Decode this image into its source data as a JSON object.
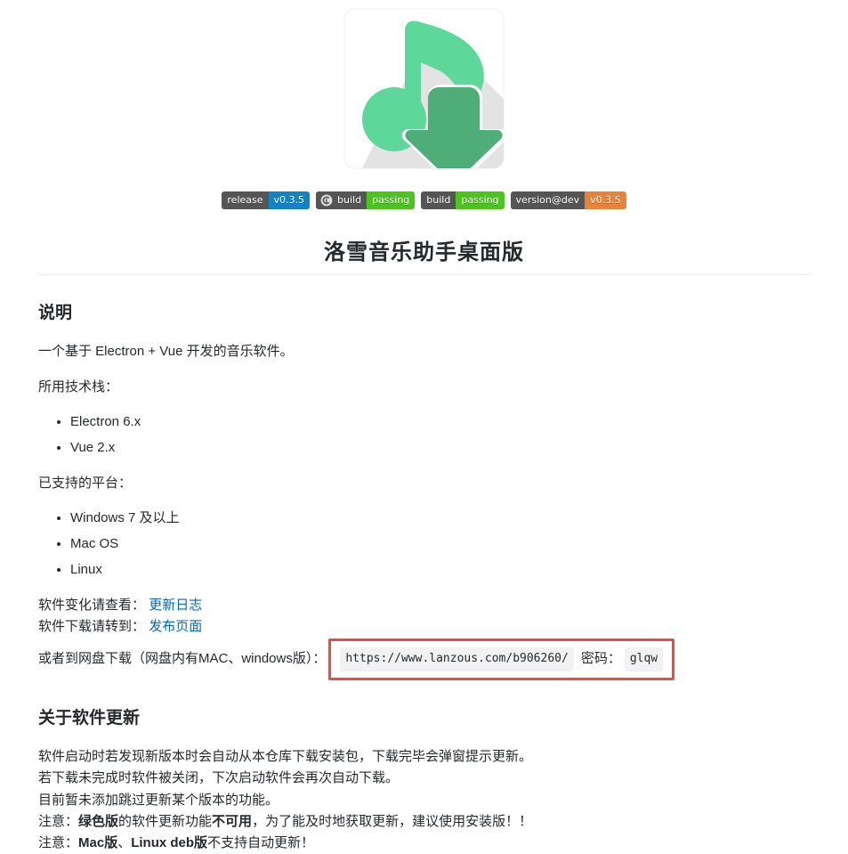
{
  "logo": {
    "name": "lx-music-logo",
    "colors": {
      "note_green": "#5ed79b",
      "arrow_green": "#4fae78",
      "shadow_gray": "#e2e2e2",
      "plate_white": "#ffffff"
    }
  },
  "badges": [
    {
      "name": "release-badge",
      "left_label": "release",
      "right_label": "v0.3.5",
      "left_color": "#555555",
      "right_color": "#1283c3",
      "icon": null
    },
    {
      "name": "travis-build-badge",
      "left_label": "build",
      "right_label": "passing",
      "left_color": "#555555",
      "right_color": "#4bc51d",
      "icon": "travis-ci-icon"
    },
    {
      "name": "build-badge",
      "left_label": "build",
      "right_label": "passing",
      "left_color": "#555555",
      "right_color": "#4bc51d",
      "icon": null
    },
    {
      "name": "version-dev-badge",
      "left_label": "version@dev",
      "right_label": "v0.3.5",
      "left_color": "#555555",
      "right_color": "#e8833a",
      "icon": null
    }
  ],
  "title": "洛雪音乐助手桌面版",
  "sections": {
    "description": {
      "heading": "说明",
      "intro": "一个基于 Electron + Vue 开发的音乐软件。",
      "stack_label": "所用技术栈：",
      "stack_items": [
        "Electron 6.x",
        "Vue 2.x"
      ],
      "platform_label": "已支持的平台：",
      "platform_items": [
        "Windows 7 及以上",
        "Mac OS",
        "Linux"
      ],
      "changelog_prefix": "软件变化请查看：",
      "changelog_link": "更新日志",
      "download_prefix": "软件下载请转到：",
      "download_link": "发布页面",
      "netdisk_prefix": "或者到网盘下载（网盘内有MAC、windows版）：",
      "netdisk_url": "https://www.lanzous.com/b906260/",
      "password_label": "密码：",
      "password_value": "glqw"
    },
    "update": {
      "heading": "关于软件更新",
      "lines": [
        "软件启动时若发现新版本时会自动从本仓库下载安装包，下载完毕会弹窗提示更新。",
        "若下载未完成时软件被关闭，下次启动软件会再次自动下载。",
        "目前暂未添加跳过更新某个版本的功能。"
      ],
      "note1": {
        "prefix": "注意：",
        "bold1": "绿色版",
        "mid": "的软件更新功能",
        "bold2": "不可用",
        "suffix": "，为了能及时地获取更新，建议使用安装版！！"
      },
      "note2": {
        "prefix": "注意：",
        "bold1": "Mac版",
        "mid": "、",
        "bold2": "Linux deb版",
        "suffix": "不支持自动更新！"
      }
    }
  },
  "colors": {
    "link": "#0366d6",
    "text": "#24292e",
    "highlight_border": "#ed4a43",
    "code_bg": "#f2f2f2",
    "rule": "#eaecef"
  }
}
